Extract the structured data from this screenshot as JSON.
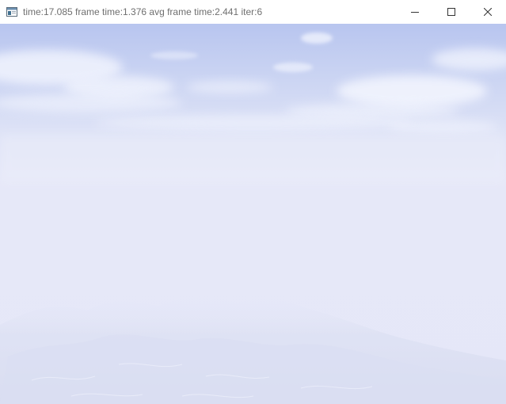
{
  "window": {
    "title": "time:17.085 frame time:1.376 avg frame time:2.441 iter:6",
    "icon": "app-window-icon",
    "controls": [
      {
        "name": "minimize",
        "icon": "minimize-icon"
      },
      {
        "name": "maximize",
        "icon": "maximize-icon"
      },
      {
        "name": "close",
        "icon": "close-icon"
      }
    ]
  },
  "viewport": {
    "scene": "rendered sky with clouds over hazy mountain terrain",
    "colors": {
      "sky_top": "#b9c6ee",
      "haze": "#e5e7f8",
      "cloud": "#f4f6ff",
      "terrain": "#dfe2f3"
    }
  }
}
